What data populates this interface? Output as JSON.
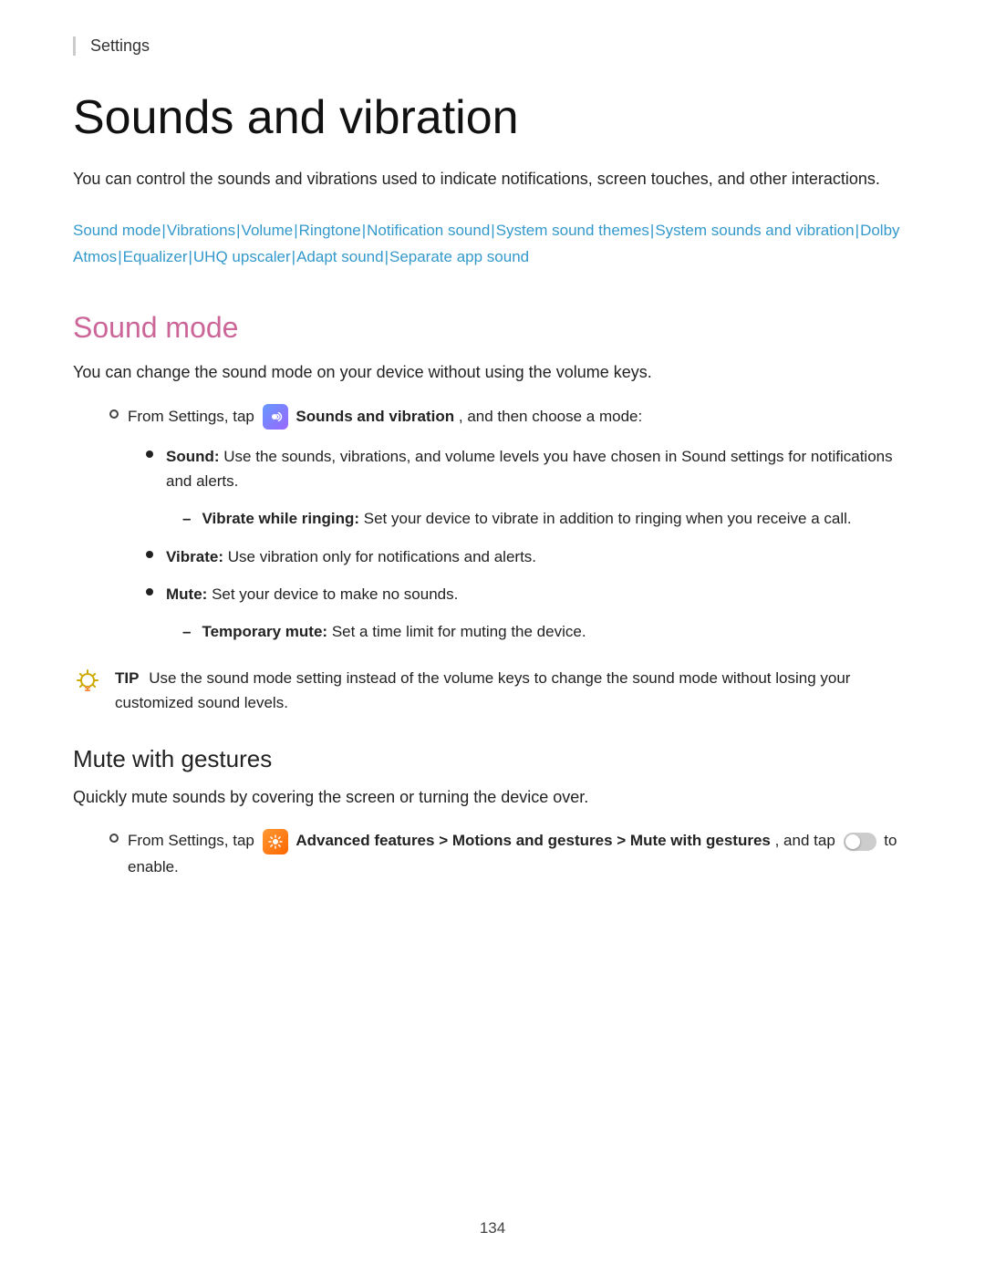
{
  "breadcrumb": {
    "text": "Settings"
  },
  "page": {
    "title": "Sounds and vibration",
    "intro": "You can control the sounds and vibrations used to indicate notifications, screen touches, and other interactions.",
    "links": [
      "Sound mode",
      "Vibrations",
      "Volume",
      "Ringtone",
      "Notification sound",
      "System sound themes",
      "System sounds and vibration",
      "Dolby Atmos",
      "Equalizer",
      "UHQ upscaler",
      "Adapt sound",
      "Separate app sound"
    ],
    "footer_page": "134"
  },
  "sound_mode_section": {
    "title": "Sound mode",
    "description": "You can change the sound mode on your device without using the volume keys.",
    "bullet1": {
      "prefix": "From Settings, tap",
      "icon_label": "sounds-and-vibration-icon",
      "bold_text": "Sounds and vibration",
      "suffix": ", and then choose a mode:"
    },
    "sub_bullets": [
      {
        "term": "Sound:",
        "text": "Use the sounds, vibrations, and volume levels you have chosen in Sound settings for notifications and alerts."
      },
      {
        "term": "Vibrate:",
        "text": "Use vibration only for notifications and alerts."
      },
      {
        "term": "Mute:",
        "text": "Set your device to make no sounds."
      }
    ],
    "level3_bullets": [
      {
        "parent_index": 0,
        "term": "Vibrate while ringing:",
        "text": "Set your device to vibrate in addition to ringing when you receive a call."
      },
      {
        "parent_index": 2,
        "term": "Temporary mute:",
        "text": "Set a time limit for muting the device."
      }
    ],
    "tip": {
      "label": "TIP",
      "text": "Use the sound mode setting instead of the volume keys to change the sound mode without losing your customized sound levels."
    }
  },
  "mute_gestures_section": {
    "title": "Mute with gestures",
    "description": "Quickly mute sounds by covering the screen or turning the device over.",
    "bullet1": {
      "prefix": "From Settings, tap",
      "icon_label": "advanced-features-icon",
      "bold_text": "Advanced features > Motions and gestures > Mute with gestures",
      "suffix": ", and tap",
      "suffix2": "to enable."
    }
  }
}
